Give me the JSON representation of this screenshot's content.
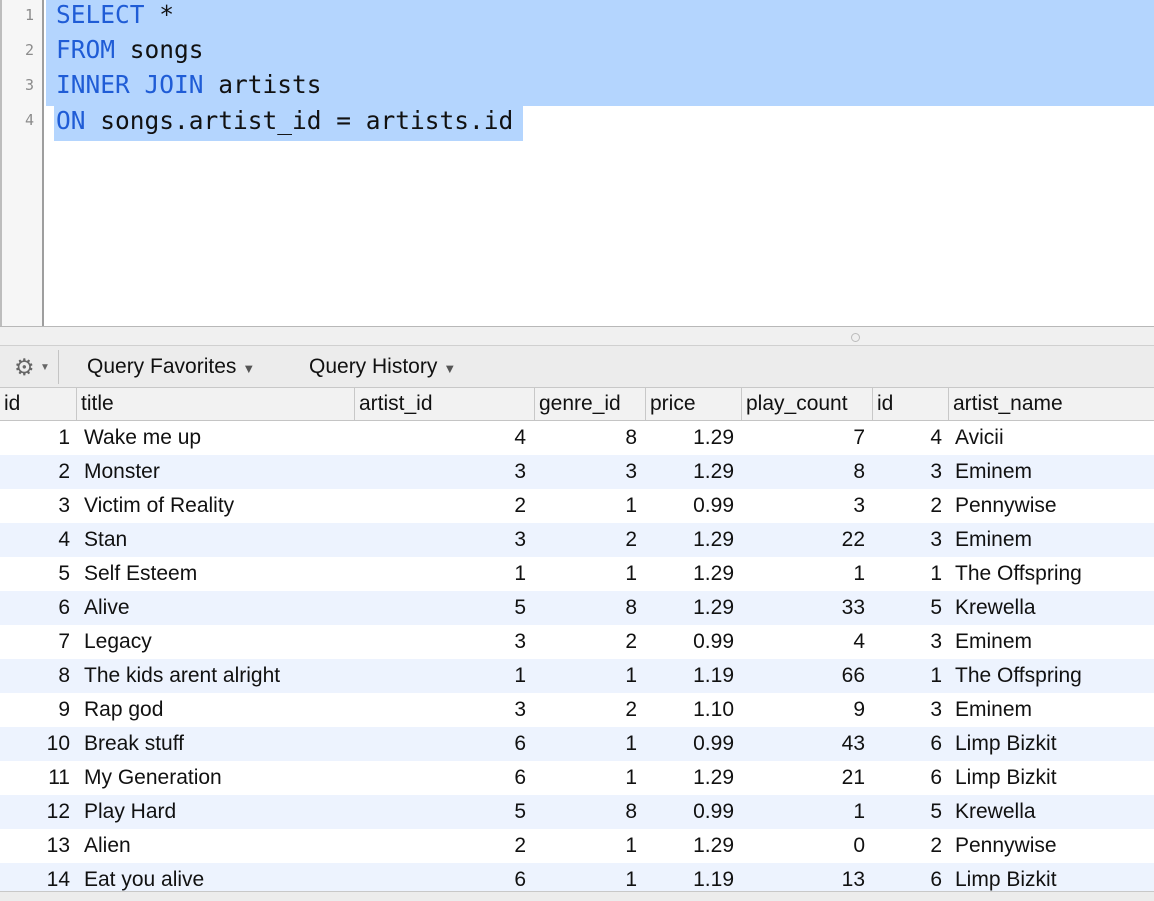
{
  "editor": {
    "lines": [
      {
        "num": "1",
        "keyword": "SELECT",
        "rest": " *"
      },
      {
        "num": "2",
        "keyword": "FROM",
        "rest": " songs"
      },
      {
        "num": "3",
        "keyword": "INNER JOIN",
        "rest": " artists"
      },
      {
        "num": "4",
        "keyword": "ON",
        "rest": " songs.artist_id = artists.id"
      }
    ]
  },
  "toolbar": {
    "gear_icon": "gear-icon",
    "query_favorites": "Query Favorites",
    "query_history": "Query History",
    "caret": "▼"
  },
  "results": {
    "columns": [
      "id",
      "title",
      "artist_id",
      "genre_id",
      "price",
      "play_count",
      "id",
      "artist_name"
    ],
    "rows": [
      [
        "1",
        "Wake me up",
        "4",
        "8",
        "1.29",
        "7",
        "4",
        "Avicii"
      ],
      [
        "2",
        "Monster",
        "3",
        "3",
        "1.29",
        "8",
        "3",
        "Eminem"
      ],
      [
        "3",
        "Victim of Reality",
        "2",
        "1",
        "0.99",
        "3",
        "2",
        "Pennywise"
      ],
      [
        "4",
        "Stan",
        "3",
        "2",
        "1.29",
        "22",
        "3",
        "Eminem"
      ],
      [
        "5",
        "Self Esteem",
        "1",
        "1",
        "1.29",
        "1",
        "1",
        "The Offspring"
      ],
      [
        "6",
        "Alive",
        "5",
        "8",
        "1.29",
        "33",
        "5",
        "Krewella"
      ],
      [
        "7",
        "Legacy",
        "3",
        "2",
        "0.99",
        "4",
        "3",
        "Eminem"
      ],
      [
        "8",
        "The kids arent alright",
        "1",
        "1",
        "1.19",
        "66",
        "1",
        "The Offspring"
      ],
      [
        "9",
        "Rap god",
        "3",
        "2",
        "1.10",
        "9",
        "3",
        "Eminem"
      ],
      [
        "10",
        "Break stuff",
        "6",
        "1",
        "0.99",
        "43",
        "6",
        "Limp Bizkit"
      ],
      [
        "11",
        "My Generation",
        "6",
        "1",
        "1.29",
        "21",
        "6",
        "Limp Bizkit"
      ],
      [
        "12",
        "Play Hard",
        "5",
        "8",
        "0.99",
        "1",
        "5",
        "Krewella"
      ],
      [
        "13",
        "Alien",
        "2",
        "1",
        "1.29",
        "0",
        "2",
        "Pennywise"
      ],
      [
        "14",
        "Eat you alive",
        "6",
        "1",
        "1.19",
        "13",
        "6",
        "Limp Bizkit"
      ]
    ]
  }
}
